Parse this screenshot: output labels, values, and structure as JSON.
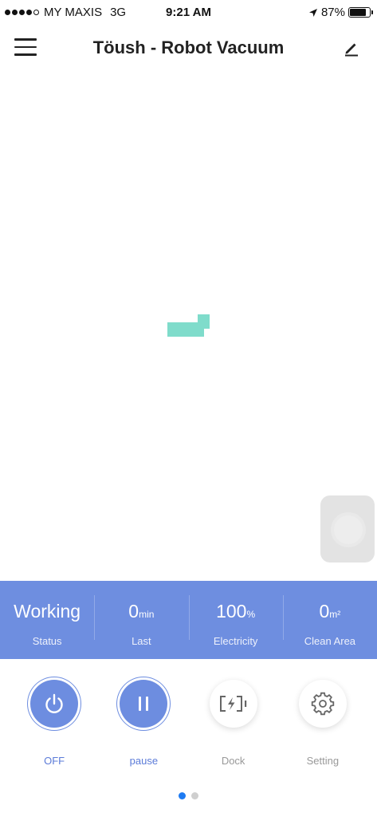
{
  "status_bar": {
    "carrier": "MY MAXIS",
    "network": "3G",
    "time": "9:21 AM",
    "battery_text": "87%",
    "battery_level": 0.87,
    "signal_bars": 4
  },
  "header": {
    "title": "Töush - Robot Vacuum",
    "menu_icon": "menu-icon",
    "edit_icon": "edit-icon"
  },
  "stats": [
    {
      "value": "Working",
      "unit": "",
      "label": "Status"
    },
    {
      "value": "0",
      "unit": "min",
      "label": "Last"
    },
    {
      "value": "100",
      "unit": "%",
      "label": "Electricity"
    },
    {
      "value": "0",
      "unit": "m²",
      "label": "Clean Area"
    }
  ],
  "controls": [
    {
      "label": "OFF",
      "icon": "power-icon"
    },
    {
      "label": "pause",
      "icon": "pause-icon"
    },
    {
      "label": "Dock",
      "icon": "dock-charge-icon"
    },
    {
      "label": "Setting",
      "icon": "gear-icon"
    }
  ],
  "pager": {
    "total": 2,
    "active": 1
  },
  "colors": {
    "accent": "#6e8ee0",
    "map_area": "#7fdccb",
    "pager_active": "#1e7bf2"
  }
}
